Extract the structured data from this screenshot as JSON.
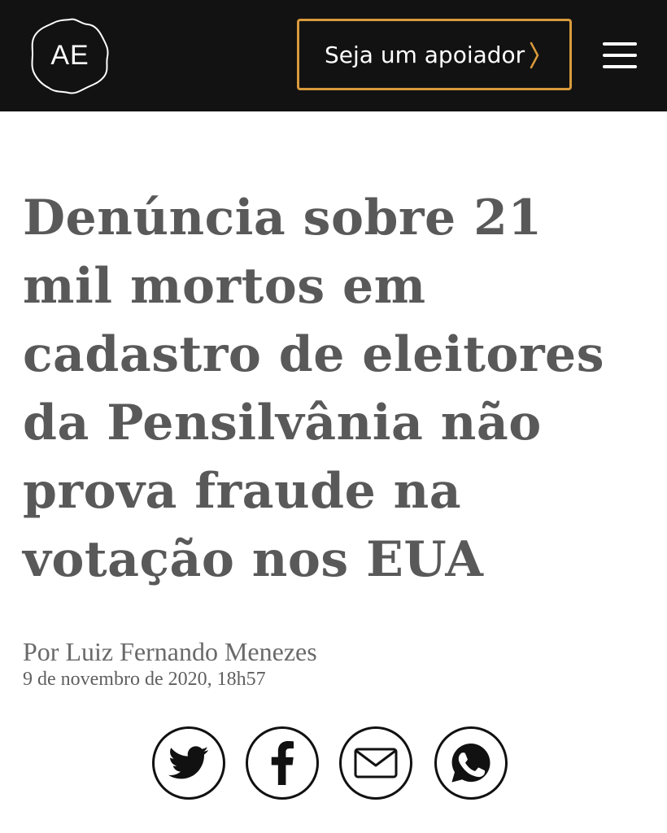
{
  "header": {
    "logo_text": "AE",
    "support_button_label": "Seja um apoiador",
    "accent_color": "#d99a3c",
    "background_color": "#121212"
  },
  "article": {
    "headline": "Denúncia sobre 21 mil mortos em cadastro de eleitores da Pensilvânia não prova fraude na votação nos EUA",
    "byline": "Por Luiz Fernando Menezes",
    "date": "9 de novembro de 2020, 18h57"
  },
  "share": {
    "icons": [
      "twitter-icon",
      "facebook-icon",
      "email-icon",
      "whatsapp-icon"
    ]
  }
}
